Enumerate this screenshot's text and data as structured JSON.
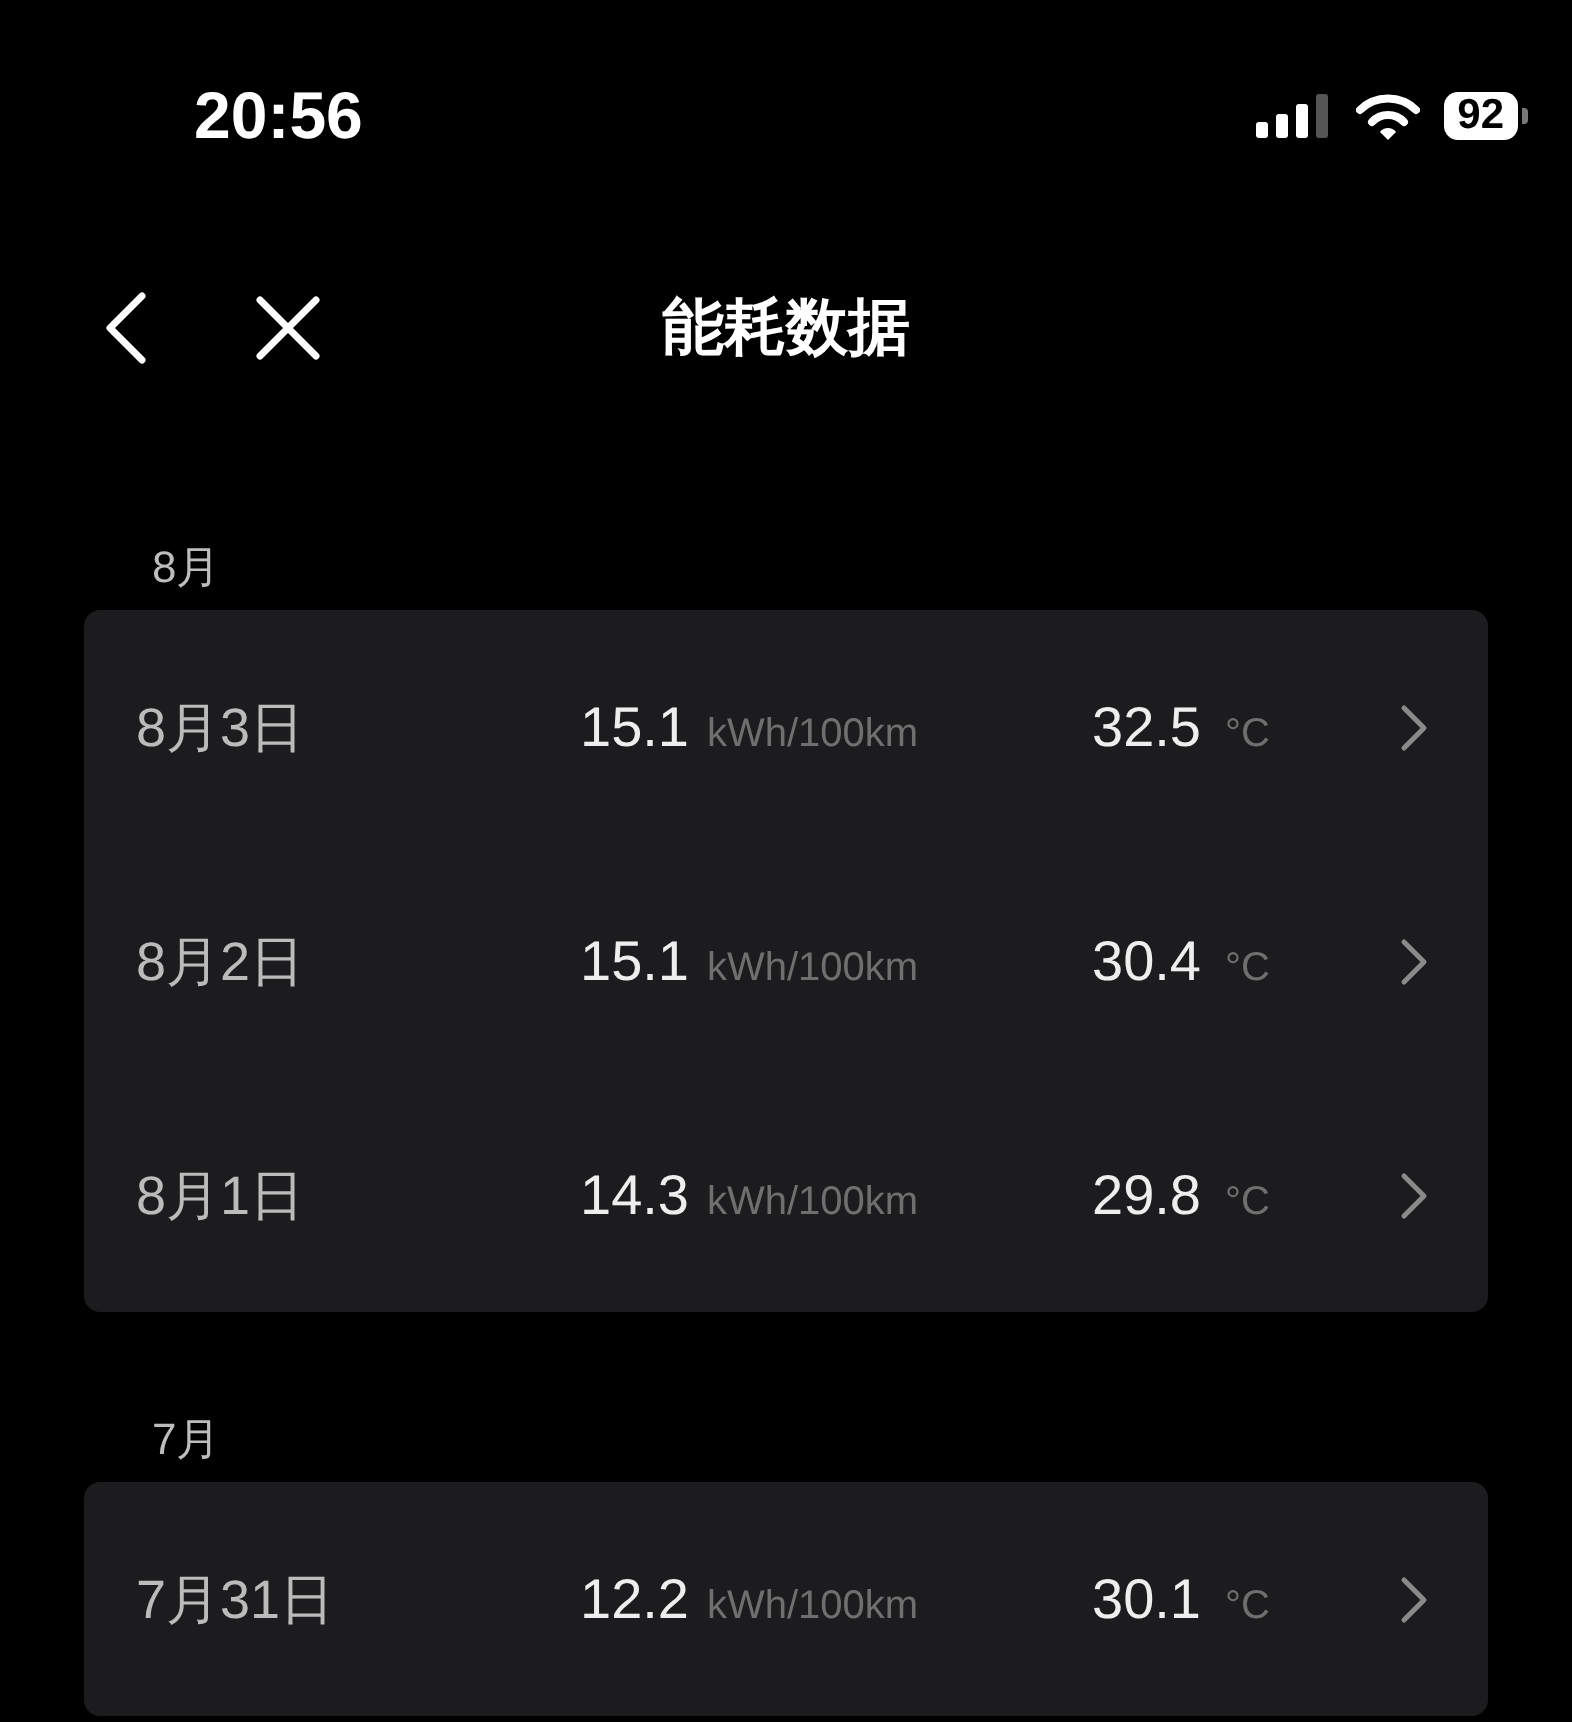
{
  "status_bar": {
    "time": "20:56",
    "battery": "92"
  },
  "nav": {
    "title": "能耗数据"
  },
  "sections": [
    {
      "month": "8月",
      "rows": [
        {
          "date": "8月3日",
          "consumption": "15.1",
          "consumption_unit": "kWh/100km",
          "temperature": "32.5",
          "temperature_unit": "°C"
        },
        {
          "date": "8月2日",
          "consumption": "15.1",
          "consumption_unit": "kWh/100km",
          "temperature": "30.4",
          "temperature_unit": "°C"
        },
        {
          "date": "8月1日",
          "consumption": "14.3",
          "consumption_unit": "kWh/100km",
          "temperature": "29.8",
          "temperature_unit": "°C"
        }
      ]
    },
    {
      "month": "7月",
      "rows": [
        {
          "date": "7月31日",
          "consumption": "12.2",
          "consumption_unit": "kWh/100km",
          "temperature": "30.1",
          "temperature_unit": "°C"
        }
      ]
    }
  ]
}
